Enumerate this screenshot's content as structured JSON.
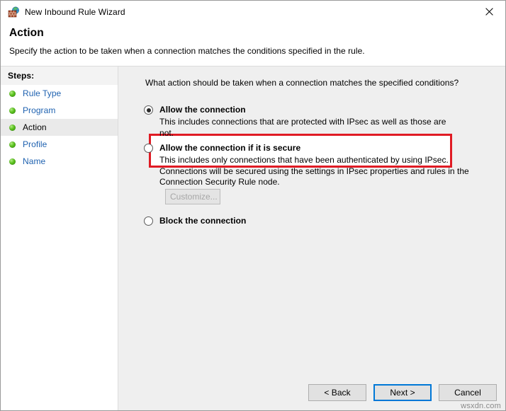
{
  "window": {
    "title": "New Inbound Rule Wizard",
    "icon": "firewall-brick-globe-icon",
    "close_label": "×"
  },
  "header": {
    "title": "Action",
    "subtitle": "Specify the action to be taken when a connection matches the conditions specified in the rule."
  },
  "sidebar": {
    "heading": "Steps:",
    "items": [
      {
        "label": "Rule Type",
        "current": false
      },
      {
        "label": "Program",
        "current": false
      },
      {
        "label": "Action",
        "current": true
      },
      {
        "label": "Profile",
        "current": false
      },
      {
        "label": "Name",
        "current": false
      }
    ]
  },
  "main": {
    "question": "What action should be taken when a connection matches the specified conditions?",
    "options": [
      {
        "title": "Allow the connection",
        "description": "This includes connections that are protected with IPsec as well as those are not.",
        "selected": true,
        "highlighted": true
      },
      {
        "title": "Allow the connection if it is secure",
        "description": "This includes only connections that have been authenticated by using IPsec.  Connections will be secured using the settings in IPsec properties and rules in the Connection Security Rule node.",
        "selected": false,
        "highlighted": false
      },
      {
        "title": "Block the connection",
        "description": "",
        "selected": false,
        "highlighted": false
      }
    ],
    "customize_button": {
      "label": "Customize...",
      "enabled": false
    }
  },
  "footer": {
    "back_label": "< Back",
    "next_label": "Next >",
    "cancel_label": "Cancel",
    "default_button": "Next >"
  },
  "watermark": "wsxdn.com",
  "colors": {
    "highlight_red": "#e01b24",
    "link_blue": "#1f62b0",
    "focus_blue": "#0078d7",
    "panel_grey": "#efefef",
    "step_bullet_green": "#5cc21f"
  }
}
